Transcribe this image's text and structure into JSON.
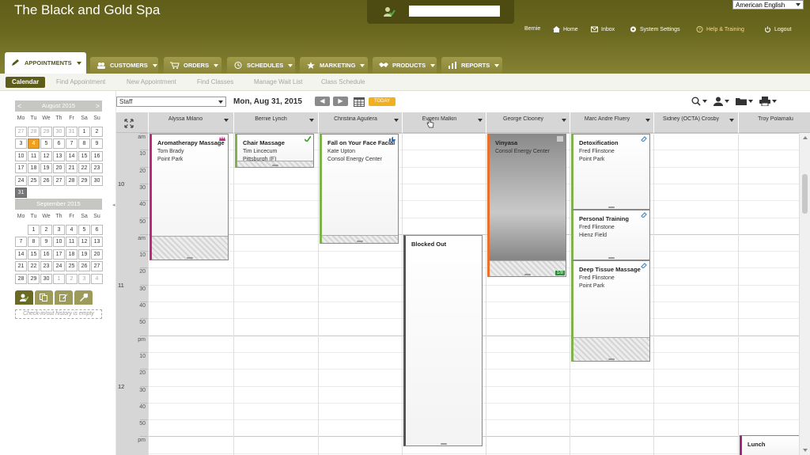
{
  "app": {
    "title": "The Black and Gold Spa"
  },
  "checkin": {
    "placeholder": ""
  },
  "language": {
    "selected": "American English"
  },
  "toplinks": {
    "user": "Bernie",
    "home": "Home",
    "inbox": "Inbox",
    "settings": "System Settings",
    "help": "Help & Training",
    "logout": "Logout"
  },
  "tabs": [
    {
      "label": "APPOINTMENTS",
      "icon": "pencil-icon"
    },
    {
      "label": "CUSTOMERS",
      "icon": "people-icon"
    },
    {
      "label": "ORDERS",
      "icon": "cart-icon"
    },
    {
      "label": "SCHEDULES",
      "icon": "clock-icon"
    },
    {
      "label": "MARKETING",
      "icon": "star-icon"
    },
    {
      "label": "PRODUCTS",
      "icon": "handshake-icon"
    },
    {
      "label": "REPORTS",
      "icon": "chart-icon"
    }
  ],
  "subnav": [
    "Calendar",
    "Find Appointment",
    "New Appointment",
    "Find Classes",
    "Manage Wait List",
    "Class Schedule"
  ],
  "mini_calendars": {
    "weekdays": [
      "Mo",
      "Tu",
      "We",
      "Th",
      "Fr",
      "Sa",
      "Su"
    ],
    "august": {
      "title": "August 2015",
      "prev": "<",
      "next": ">",
      "weeks": [
        [
          "27",
          "28",
          "29",
          "30",
          "31",
          "1",
          "2"
        ],
        [
          "3",
          "4",
          "5",
          "6",
          "7",
          "8",
          "9"
        ],
        [
          "10",
          "11",
          "12",
          "13",
          "14",
          "15",
          "16"
        ],
        [
          "17",
          "18",
          "19",
          "20",
          "21",
          "22",
          "23"
        ],
        [
          "24",
          "25",
          "26",
          "27",
          "28",
          "29",
          "30"
        ],
        [
          "31"
        ]
      ]
    },
    "september": {
      "title": "September 2015",
      "weeks": [
        [
          "",
          "1",
          "2",
          "3",
          "4",
          "5",
          "6"
        ],
        [
          "7",
          "8",
          "9",
          "10",
          "11",
          "12",
          "13"
        ],
        [
          "14",
          "15",
          "16",
          "17",
          "18",
          "19",
          "20"
        ],
        [
          "21",
          "22",
          "23",
          "24",
          "25",
          "26",
          "27"
        ],
        [
          "28",
          "29",
          "30",
          "1",
          "2",
          "3",
          "4"
        ]
      ]
    }
  },
  "sidebar": {
    "empty_text": "Check-in/out history is empty"
  },
  "toolbar": {
    "staff_select": "Staff",
    "date": "Mon, Aug 31, 2015",
    "today": "TODAY",
    "prev": "◀",
    "next": "▶"
  },
  "staff": [
    "Alyssa Milano",
    "Bernie Lynch",
    "Christina Aguilera",
    "Evgeni Malkin",
    "George Clooney",
    "Marc Andre Fluery",
    "Sidney (OCTA) Crosby",
    "Troy Polamalu"
  ],
  "time_labels": {
    "hours": [
      {
        "hour": "10",
        "marks": [
          "am",
          "10",
          "20",
          "30",
          "40",
          "50"
        ]
      },
      {
        "hour": "11",
        "marks": [
          "am",
          "10",
          "20",
          "30",
          "40",
          "50"
        ]
      },
      {
        "hour": "12",
        "marks": [
          "pm",
          "10",
          "20",
          "30",
          "40",
          "50"
        ]
      },
      {
        "hour": "",
        "marks": [
          "pm"
        ]
      }
    ]
  },
  "appointments": [
    {
      "title": "Aromatherapy Massage",
      "line1": "Tom Brady",
      "line2": "Point Park",
      "color": "#c0267e",
      "icon": "crown-icon"
    },
    {
      "title": "Chair Massage",
      "line1": "Tim Lincecum",
      "line2": "Pittsburgh (F)",
      "color": "#7fb24c",
      "icon": "check-icon"
    },
    {
      "title": "Fall on Your Face Facial",
      "line1": "Kate Upton",
      "line2": "Consol Energy Center",
      "color": "#7fb24c",
      "icon": "thumbs-up-icon"
    },
    {
      "title": "Blocked Out",
      "line1": "",
      "line2": "",
      "color": "#555555",
      "icon": ""
    },
    {
      "title": "Vinyasa",
      "line1": "Consol Energy Center",
      "line2": "",
      "color": "#e8702a",
      "icon": "note-icon",
      "badge": "1/8"
    },
    {
      "title": "Detoxification",
      "line1": "Fred Flinstone",
      "line2": "Point Park",
      "color": "#7fb24c",
      "icon": "link-icon"
    },
    {
      "title": "Personal Training",
      "line1": "Fred Flinstone",
      "line2": "Hienz Field",
      "color": "#7fb24c",
      "icon": "link-icon"
    },
    {
      "title": "Deep Tissue Massage",
      "line1": "Fred Flinstone",
      "line2": "Point Park",
      "color": "#7fb24c",
      "icon": "link-icon"
    },
    {
      "title": "Lunch",
      "line1": "",
      "line2": "",
      "color": "#a0267e",
      "icon": ""
    }
  ],
  "colors": {
    "header_dark": "#5f5d18",
    "accent_orange": "#f0b020"
  }
}
